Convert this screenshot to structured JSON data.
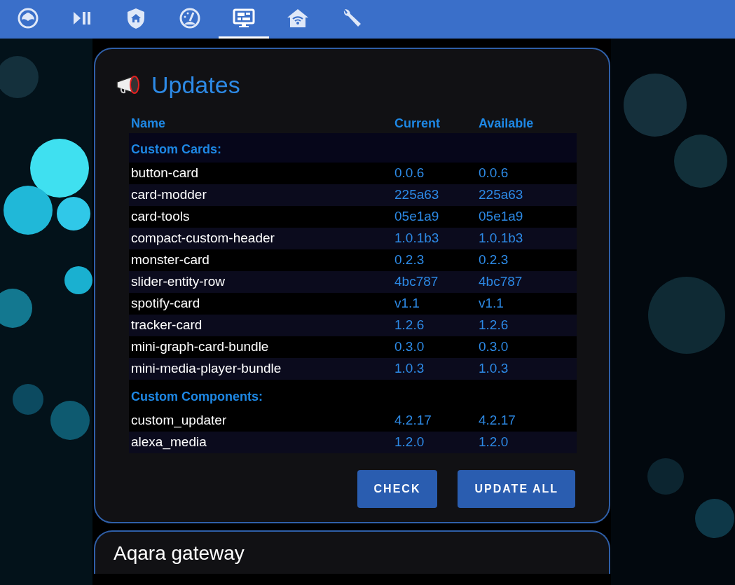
{
  "tabs": [
    {
      "selected": false
    },
    {
      "selected": false
    },
    {
      "selected": false
    },
    {
      "selected": false
    },
    {
      "selected": true
    },
    {
      "selected": false
    },
    {
      "selected": false
    }
  ],
  "card": {
    "title": "Updates",
    "columns": [
      "Name",
      "Current",
      "Available"
    ],
    "sections": [
      {
        "title": "Custom Cards:",
        "rows": [
          [
            "button-card",
            "0.0.6",
            "0.0.6"
          ],
          [
            "card-modder",
            "225a63",
            "225a63"
          ],
          [
            "card-tools",
            "05e1a9",
            "05e1a9"
          ],
          [
            "compact-custom-header",
            "1.0.1b3",
            "1.0.1b3"
          ],
          [
            "monster-card",
            "0.2.3",
            "0.2.3"
          ],
          [
            "slider-entity-row",
            "4bc787",
            "4bc787"
          ],
          [
            "spotify-card",
            "v1.1",
            "v1.1"
          ],
          [
            "tracker-card",
            "1.2.6",
            "1.2.6"
          ],
          [
            "mini-graph-card-bundle",
            "0.3.0",
            "0.3.0"
          ],
          [
            "mini-media-player-bundle",
            "1.0.3",
            "1.0.3"
          ]
        ]
      },
      {
        "title": "Custom Components:",
        "rows": [
          [
            "custom_updater",
            "4.2.17",
            "4.2.17"
          ],
          [
            "alexa_media",
            "1.2.0",
            "1.2.0"
          ]
        ]
      }
    ],
    "buttons": [
      "CHECK",
      "UPDATE ALL"
    ]
  },
  "next_card": {
    "title": "Aqara gateway"
  }
}
